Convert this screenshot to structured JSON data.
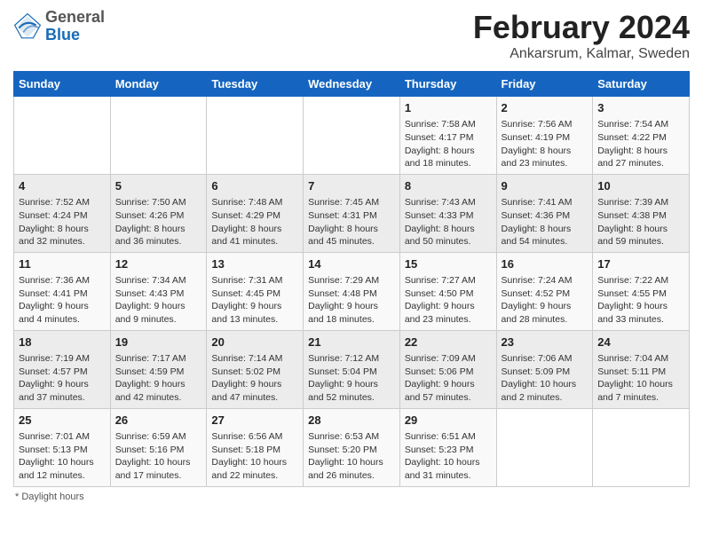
{
  "header": {
    "logo_line1": "General",
    "logo_line2": "Blue",
    "title": "February 2024",
    "subtitle": "Ankarsrum, Kalmar, Sweden"
  },
  "calendar": {
    "days_of_week": [
      "Sunday",
      "Monday",
      "Tuesday",
      "Wednesday",
      "Thursday",
      "Friday",
      "Saturday"
    ],
    "weeks": [
      [
        {
          "day": "",
          "info": ""
        },
        {
          "day": "",
          "info": ""
        },
        {
          "day": "",
          "info": ""
        },
        {
          "day": "",
          "info": ""
        },
        {
          "day": "1",
          "info": "Sunrise: 7:58 AM\nSunset: 4:17 PM\nDaylight: 8 hours\nand 18 minutes."
        },
        {
          "day": "2",
          "info": "Sunrise: 7:56 AM\nSunset: 4:19 PM\nDaylight: 8 hours\nand 23 minutes."
        },
        {
          "day": "3",
          "info": "Sunrise: 7:54 AM\nSunset: 4:22 PM\nDaylight: 8 hours\nand 27 minutes."
        }
      ],
      [
        {
          "day": "4",
          "info": "Sunrise: 7:52 AM\nSunset: 4:24 PM\nDaylight: 8 hours\nand 32 minutes."
        },
        {
          "day": "5",
          "info": "Sunrise: 7:50 AM\nSunset: 4:26 PM\nDaylight: 8 hours\nand 36 minutes."
        },
        {
          "day": "6",
          "info": "Sunrise: 7:48 AM\nSunset: 4:29 PM\nDaylight: 8 hours\nand 41 minutes."
        },
        {
          "day": "7",
          "info": "Sunrise: 7:45 AM\nSunset: 4:31 PM\nDaylight: 8 hours\nand 45 minutes."
        },
        {
          "day": "8",
          "info": "Sunrise: 7:43 AM\nSunset: 4:33 PM\nDaylight: 8 hours\nand 50 minutes."
        },
        {
          "day": "9",
          "info": "Sunrise: 7:41 AM\nSunset: 4:36 PM\nDaylight: 8 hours\nand 54 minutes."
        },
        {
          "day": "10",
          "info": "Sunrise: 7:39 AM\nSunset: 4:38 PM\nDaylight: 8 hours\nand 59 minutes."
        }
      ],
      [
        {
          "day": "11",
          "info": "Sunrise: 7:36 AM\nSunset: 4:41 PM\nDaylight: 9 hours\nand 4 minutes."
        },
        {
          "day": "12",
          "info": "Sunrise: 7:34 AM\nSunset: 4:43 PM\nDaylight: 9 hours\nand 9 minutes."
        },
        {
          "day": "13",
          "info": "Sunrise: 7:31 AM\nSunset: 4:45 PM\nDaylight: 9 hours\nand 13 minutes."
        },
        {
          "day": "14",
          "info": "Sunrise: 7:29 AM\nSunset: 4:48 PM\nDaylight: 9 hours\nand 18 minutes."
        },
        {
          "day": "15",
          "info": "Sunrise: 7:27 AM\nSunset: 4:50 PM\nDaylight: 9 hours\nand 23 minutes."
        },
        {
          "day": "16",
          "info": "Sunrise: 7:24 AM\nSunset: 4:52 PM\nDaylight: 9 hours\nand 28 minutes."
        },
        {
          "day": "17",
          "info": "Sunrise: 7:22 AM\nSunset: 4:55 PM\nDaylight: 9 hours\nand 33 minutes."
        }
      ],
      [
        {
          "day": "18",
          "info": "Sunrise: 7:19 AM\nSunset: 4:57 PM\nDaylight: 9 hours\nand 37 minutes."
        },
        {
          "day": "19",
          "info": "Sunrise: 7:17 AM\nSunset: 4:59 PM\nDaylight: 9 hours\nand 42 minutes."
        },
        {
          "day": "20",
          "info": "Sunrise: 7:14 AM\nSunset: 5:02 PM\nDaylight: 9 hours\nand 47 minutes."
        },
        {
          "day": "21",
          "info": "Sunrise: 7:12 AM\nSunset: 5:04 PM\nDaylight: 9 hours\nand 52 minutes."
        },
        {
          "day": "22",
          "info": "Sunrise: 7:09 AM\nSunset: 5:06 PM\nDaylight: 9 hours\nand 57 minutes."
        },
        {
          "day": "23",
          "info": "Sunrise: 7:06 AM\nSunset: 5:09 PM\nDaylight: 10 hours\nand 2 minutes."
        },
        {
          "day": "24",
          "info": "Sunrise: 7:04 AM\nSunset: 5:11 PM\nDaylight: 10 hours\nand 7 minutes."
        }
      ],
      [
        {
          "day": "25",
          "info": "Sunrise: 7:01 AM\nSunset: 5:13 PM\nDaylight: 10 hours\nand 12 minutes."
        },
        {
          "day": "26",
          "info": "Sunrise: 6:59 AM\nSunset: 5:16 PM\nDaylight: 10 hours\nand 17 minutes."
        },
        {
          "day": "27",
          "info": "Sunrise: 6:56 AM\nSunset: 5:18 PM\nDaylight: 10 hours\nand 22 minutes."
        },
        {
          "day": "28",
          "info": "Sunrise: 6:53 AM\nSunset: 5:20 PM\nDaylight: 10 hours\nand 26 minutes."
        },
        {
          "day": "29",
          "info": "Sunrise: 6:51 AM\nSunset: 5:23 PM\nDaylight: 10 hours\nand 31 minutes."
        },
        {
          "day": "",
          "info": ""
        },
        {
          "day": "",
          "info": ""
        }
      ]
    ]
  },
  "footer": {
    "note": "Daylight hours"
  }
}
